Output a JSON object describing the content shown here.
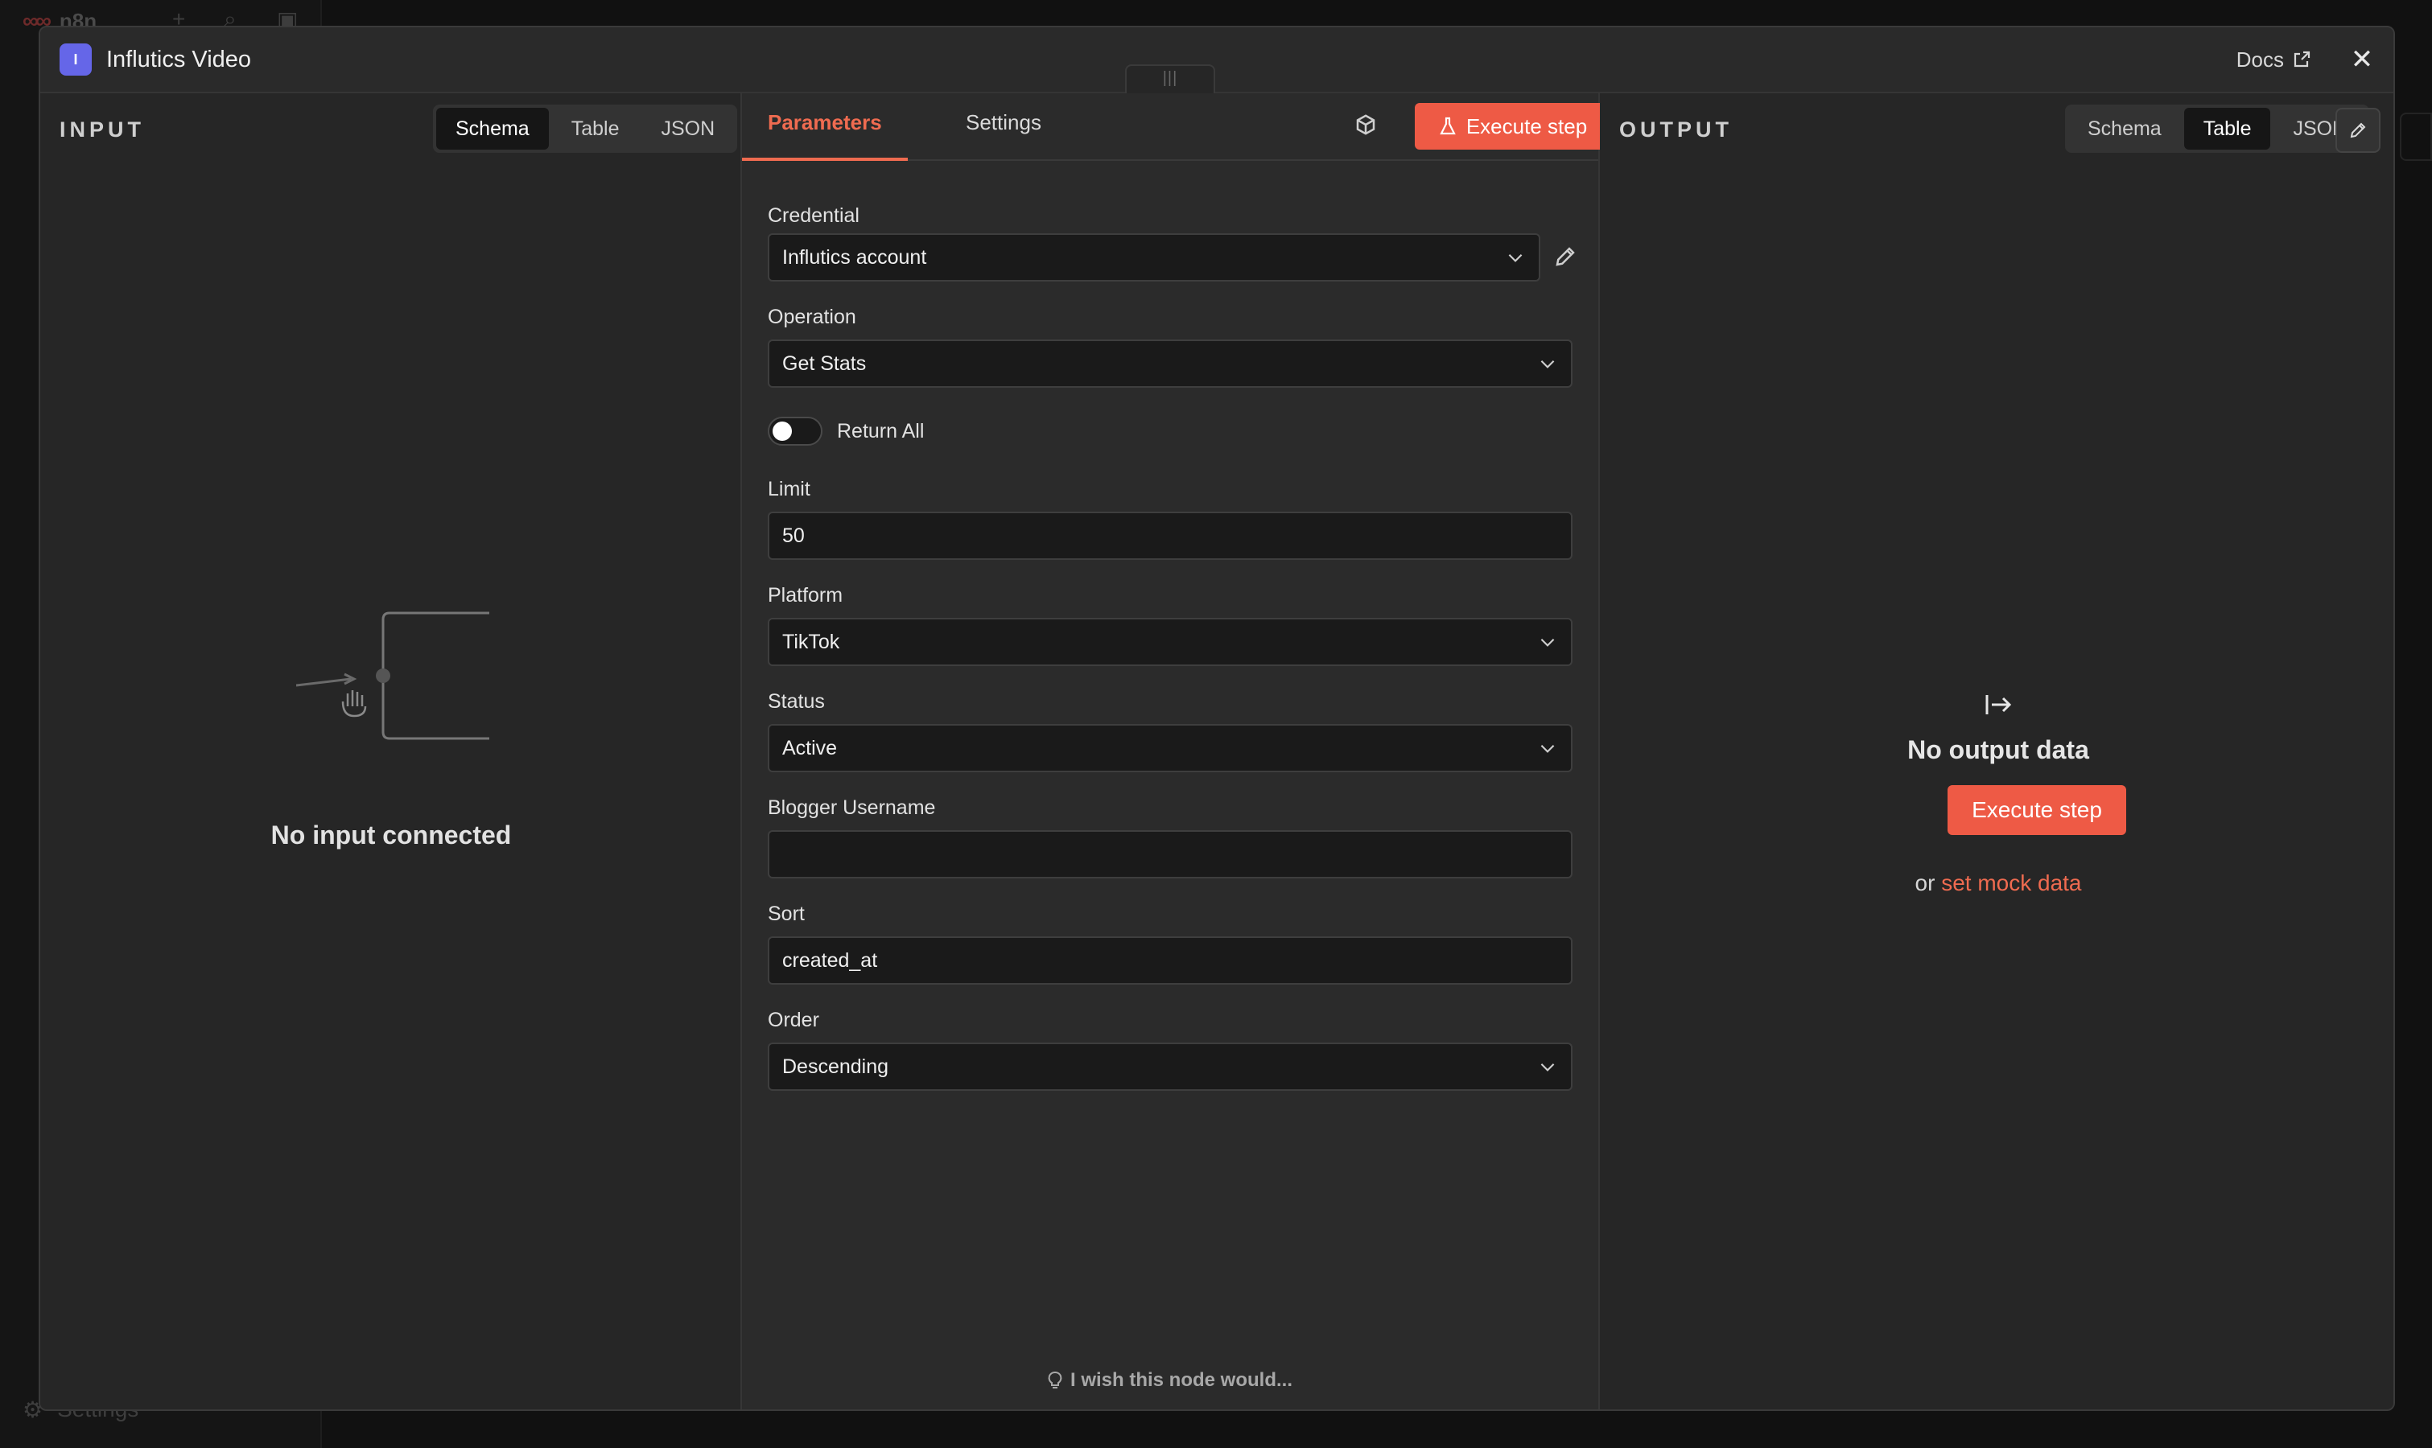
{
  "background": {
    "app_name": "n8n",
    "settings_label": "Settings"
  },
  "header": {
    "node_badge": "I",
    "title": "Influtics Video",
    "docs_label": "Docs",
    "close_glyph": "✕",
    "drag_glyph": "|||"
  },
  "input_panel": {
    "label": "INPUT",
    "view_tabs": [
      "Schema",
      "Table",
      "JSON"
    ],
    "active_view": "Schema",
    "empty_text": "No input connected"
  },
  "params_panel": {
    "tabs": {
      "parameters": "Parameters",
      "settings": "Settings"
    },
    "execute_label": "Execute step",
    "fields": {
      "credential": {
        "label": "Credential",
        "value": "Influtics account"
      },
      "operation": {
        "label": "Operation",
        "value": "Get Stats"
      },
      "return_all": {
        "label": "Return All",
        "on": false
      },
      "limit": {
        "label": "Limit",
        "value": "50"
      },
      "platform": {
        "label": "Platform",
        "value": "TikTok"
      },
      "status": {
        "label": "Status",
        "value": "Active"
      },
      "blogger_username": {
        "label": "Blogger Username",
        "value": ""
      },
      "sort": {
        "label": "Sort",
        "value": "created_at"
      },
      "order": {
        "label": "Order",
        "value": "Descending"
      }
    },
    "wish_text": "I wish this node would..."
  },
  "output_panel": {
    "label": "OUTPUT",
    "view_tabs": [
      "Schema",
      "Table",
      "JSON"
    ],
    "active_view": "Table",
    "empty_text": "No output data",
    "execute_label": "Execute step",
    "or_text": "or",
    "mock_link": "set mock data"
  },
  "colors": {
    "accent": "#ee5a45",
    "node_badge": "#6566e8",
    "panel_bg": "#262626"
  }
}
